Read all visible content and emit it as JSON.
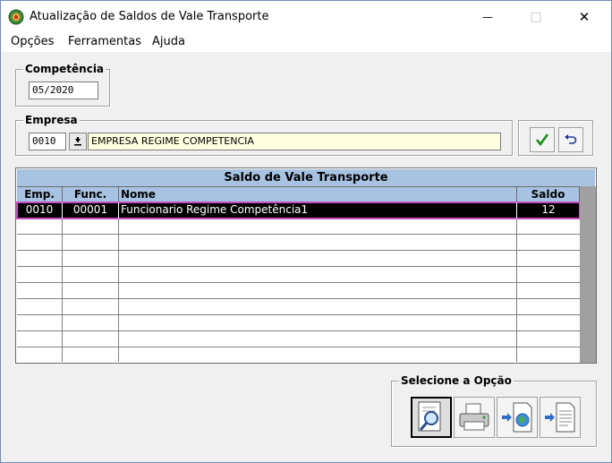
{
  "window": {
    "title": "Atualização de Saldos de Vale Transporte",
    "minimize_glyph": "—",
    "maximize_glyph": "□",
    "close_glyph": "✕"
  },
  "menu": [
    "Opções",
    "Ferramentas",
    "Ajuda"
  ],
  "competencia": {
    "label": "Competência",
    "value": "05/2020"
  },
  "empresa": {
    "label": "Empresa",
    "code": "0010",
    "name": "EMPRESA REGIME COMPETENCIA"
  },
  "actions": {
    "confirm_icon": "checkmark-icon",
    "undo_icon": "undo-icon"
  },
  "grid": {
    "title": "Saldo de Vale Transporte",
    "columns": [
      "Emp.",
      "Func.",
      "Nome",
      "Saldo"
    ],
    "rows": [
      {
        "emp": "0010",
        "func": "00001",
        "nome": "Funcionario Regime Competência1",
        "saldo": "12"
      }
    ],
    "empty_rows": 9
  },
  "options": {
    "label": "Selecione a Opção",
    "buttons": [
      "magnifier-icon",
      "printer-icon",
      "export-web-icon",
      "export-document-icon"
    ]
  },
  "colors": {
    "grid_header": "#a7c3e1",
    "selection": "#000000",
    "selection_outline": "#c44fc4",
    "confirm_green": "#1a8f1a",
    "field_yellow": "#ffffe1"
  }
}
